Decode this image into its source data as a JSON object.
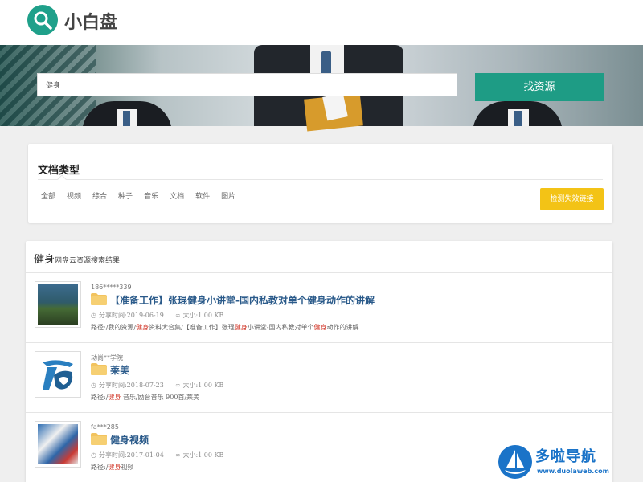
{
  "header": {
    "site_name": "小白盘",
    "logo_icon": "search-icon"
  },
  "search": {
    "value": "健身",
    "button_label": "找资源"
  },
  "doc_types": {
    "title": "文档类型",
    "items": [
      "全部",
      "视频",
      "综合",
      "种子",
      "音乐",
      "文档",
      "软件",
      "图片"
    ],
    "check_button": "检测失效链接"
  },
  "results": {
    "keyword": "健身",
    "suffix": "网盘云资源搜索结果",
    "items": [
      {
        "user": "186*****339",
        "title": "【准备工作】张琨健身小讲堂-国内私教对单个健身动作的讲解",
        "share_time": "分享时间:2019-06-19",
        "size": "大小:1.00 KB",
        "path_prefix": "路径:/我的资源/",
        "path_hl1": "健身",
        "path_mid": "资料大合集/【准备工作】张琨",
        "path_hl2": "健身",
        "path_mid2": "小讲堂-国内私教对单个",
        "path_hl3": "健身",
        "path_suffix": "动作的讲解"
      },
      {
        "user": "动尚**学院",
        "title": "莱美",
        "share_time": "分享时间:2018-07-23",
        "size": "大小:1.00 KB",
        "path_prefix": "路径:/",
        "path_hl1": "健身",
        "path_suffix": "音乐/励台音乐 900首/莱美"
      },
      {
        "user": "fa***285",
        "title": "健身视频",
        "share_time": "分享时间:2017-01-04",
        "size": "大小:1.00 KB",
        "path_prefix": "路径:/",
        "path_hl1": "健身",
        "path_suffix": "视频"
      }
    ]
  },
  "watermark": {
    "title": "多啦导航",
    "url": "www.duolaweb.com"
  },
  "colors": {
    "accent": "#1e9c85",
    "warning": "#f3c316",
    "link": "#2a5a8a",
    "highlight": "#d23a2c"
  }
}
